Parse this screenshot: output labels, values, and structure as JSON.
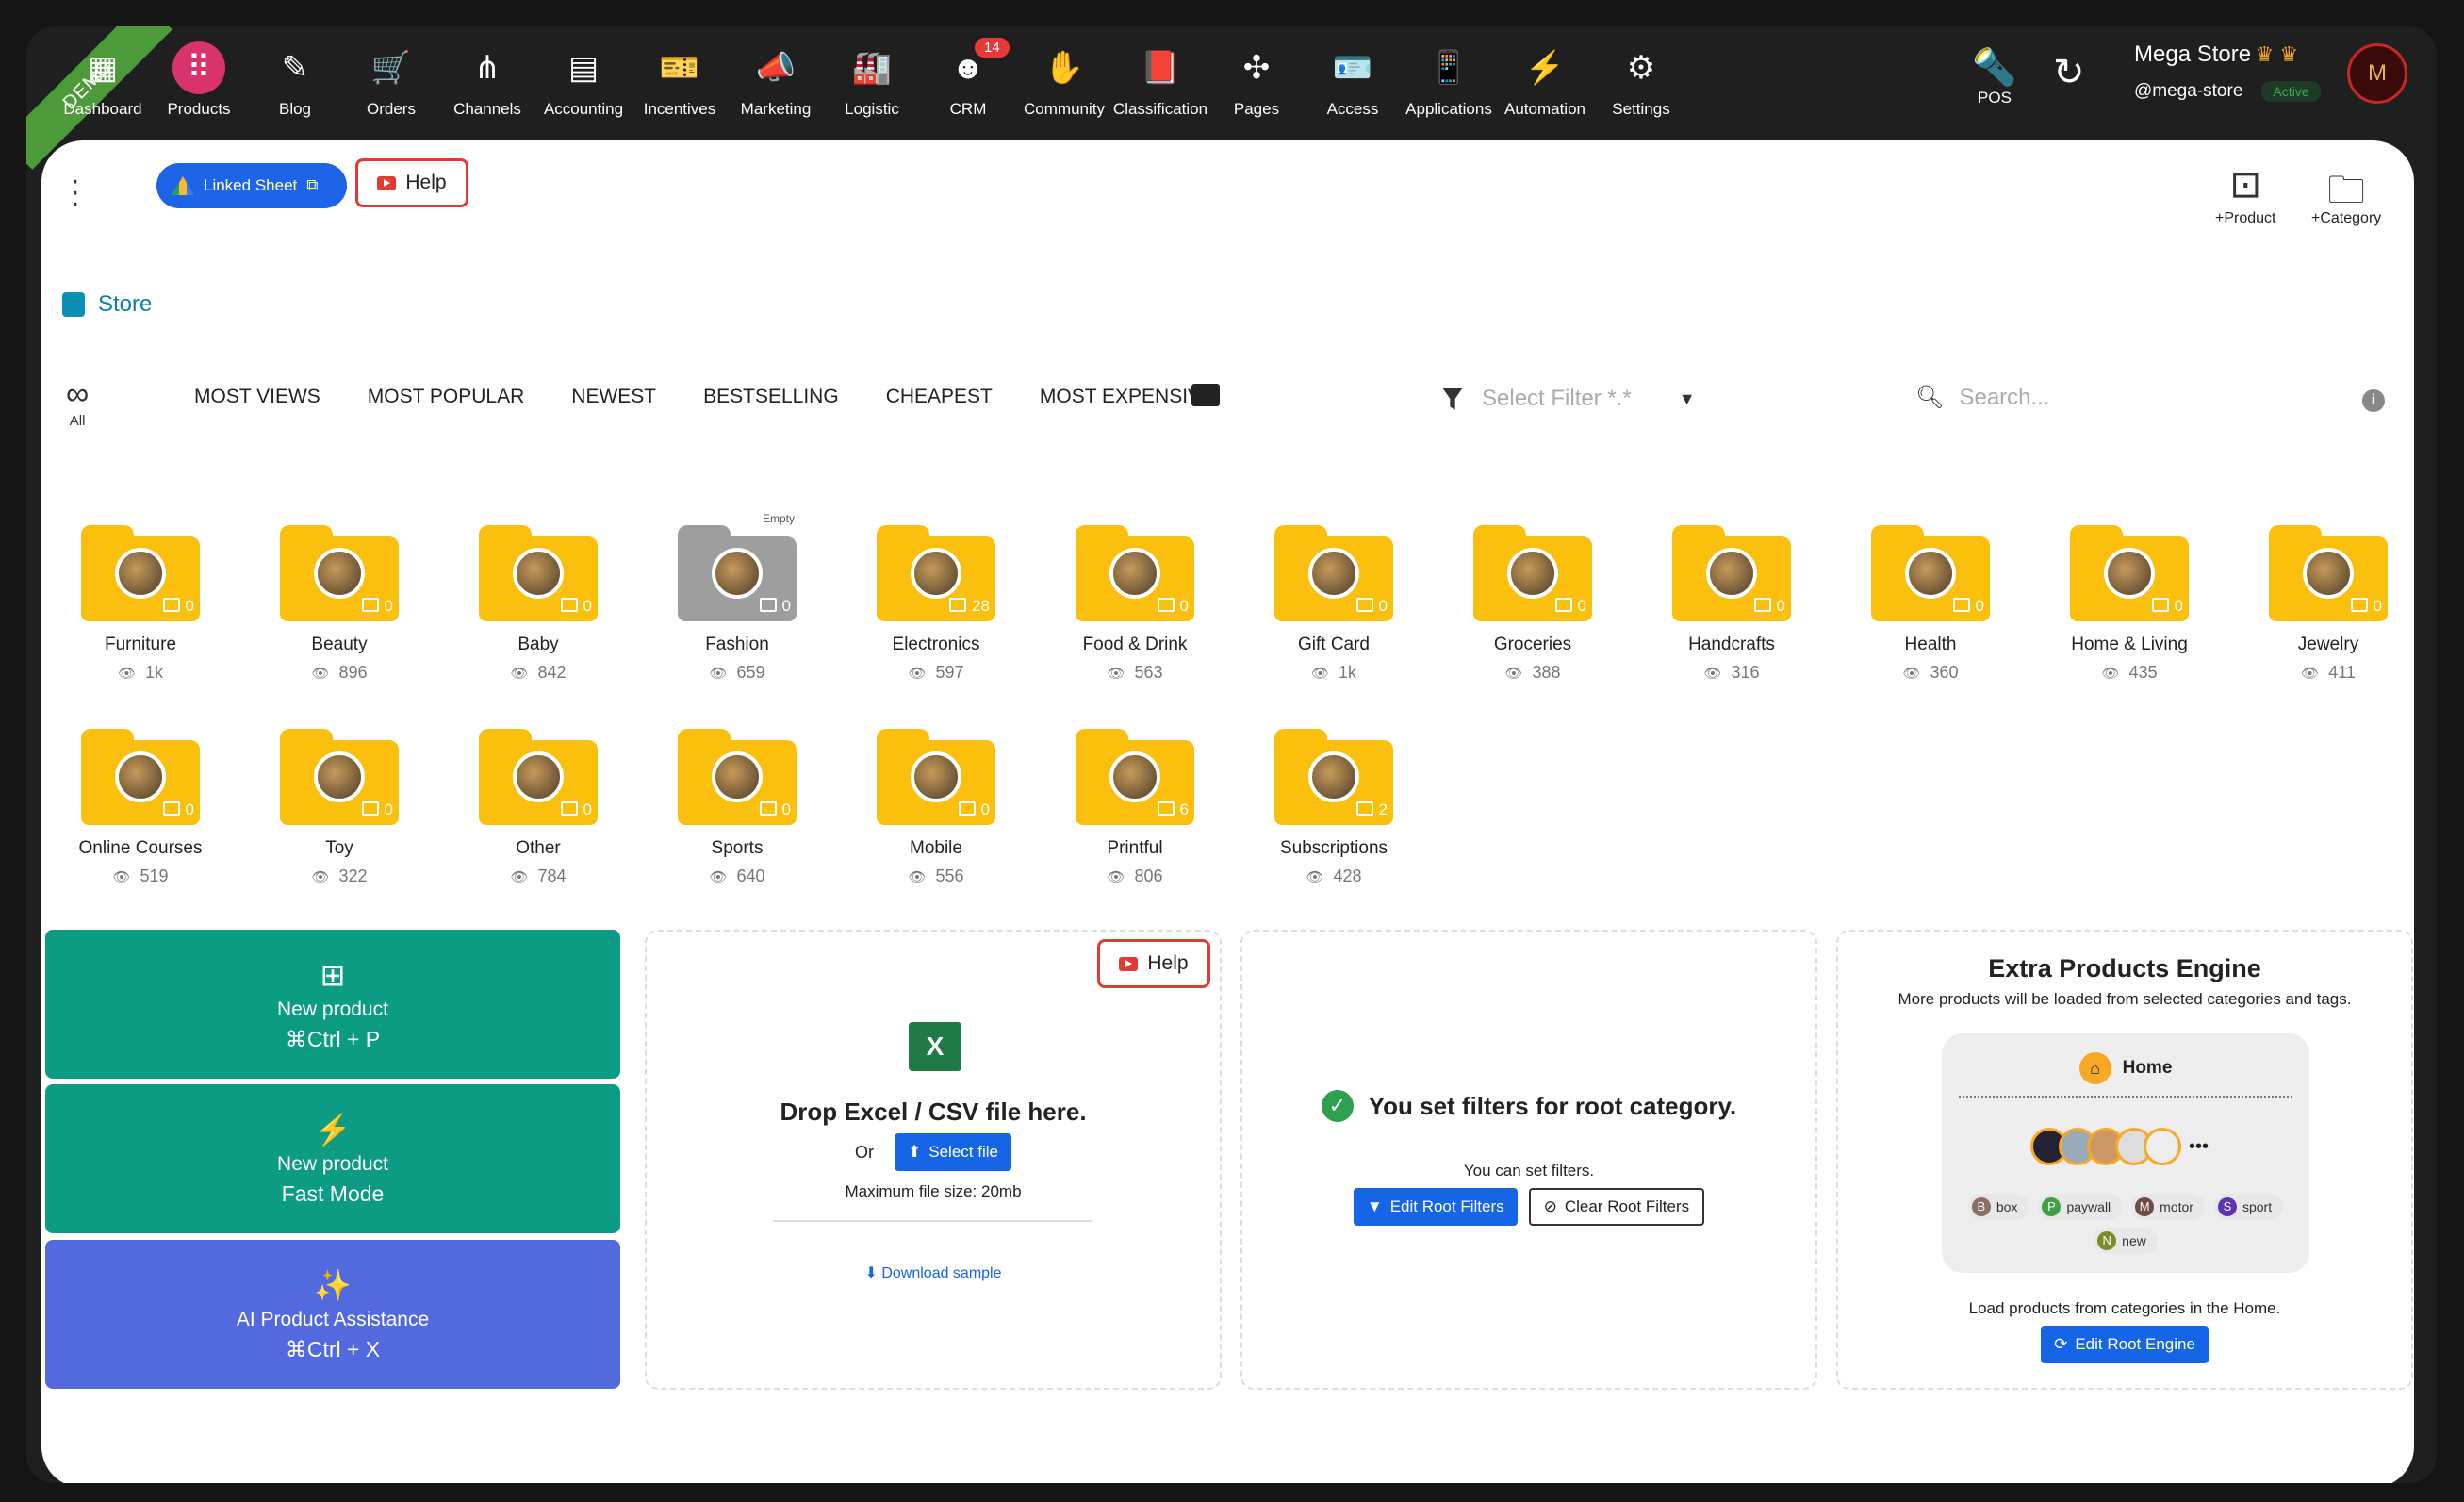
{
  "ribbon": "DEMO",
  "nav": [
    {
      "label": "Dashboard",
      "icon": "dashboard-icon",
      "glyph": "▦"
    },
    {
      "label": "Products",
      "icon": "grid-apps-icon",
      "glyph": "⠿"
    },
    {
      "label": "Blog",
      "icon": "blog-icon",
      "glyph": "✎"
    },
    {
      "label": "Orders",
      "icon": "cart-icon",
      "glyph": "🛒"
    },
    {
      "label": "Channels",
      "icon": "channels-icon",
      "glyph": "⋔"
    },
    {
      "label": "Accounting",
      "icon": "accounting-icon",
      "glyph": "▤"
    },
    {
      "label": "Incentives",
      "icon": "ticket-icon",
      "glyph": "🎫"
    },
    {
      "label": "Marketing",
      "icon": "megaphone-icon",
      "glyph": "📣"
    },
    {
      "label": "Logistic",
      "icon": "warehouse-icon",
      "glyph": "🏭"
    },
    {
      "label": "CRM",
      "icon": "crm-icon",
      "glyph": "☻",
      "badge": "14"
    },
    {
      "label": "Community",
      "icon": "hands-icon",
      "glyph": "✋"
    },
    {
      "label": "Classification",
      "icon": "book-icon",
      "glyph": "📕"
    },
    {
      "label": "Pages",
      "icon": "compass-icon",
      "glyph": "✣"
    },
    {
      "label": "Access",
      "icon": "badge-icon",
      "glyph": "🪪"
    },
    {
      "label": "Applications",
      "icon": "phone-icon",
      "glyph": "📱"
    },
    {
      "label": "Automation",
      "icon": "bolt-icon",
      "glyph": "⚡"
    },
    {
      "label": "Settings",
      "icon": "gear-icon",
      "glyph": "⚙"
    }
  ],
  "pos": {
    "label": "POS"
  },
  "store": {
    "name": "Mega Store",
    "crowns": "♛ ♛",
    "handle": "@mega-store",
    "status": "Active",
    "avatar": "M"
  },
  "toolbar": {
    "linked_sheet": "Linked Sheet",
    "help": "Help",
    "add_product": "+Product",
    "add_category": "+Category"
  },
  "breadcrumb": {
    "store": "Store"
  },
  "filters": {
    "all": "All",
    "sorts": [
      "MOST VIEWS",
      "MOST POPULAR",
      "NEWEST",
      "BESTSELLING",
      "CHEAPEST",
      "MOST EXPENSIVE"
    ],
    "select_filter": "Select Filter *.*",
    "search_placeholder": "Search..."
  },
  "categories": [
    {
      "name": "Furniture",
      "count": "0",
      "views": "1k"
    },
    {
      "name": "Beauty",
      "count": "0",
      "views": "896"
    },
    {
      "name": "Baby",
      "count": "0",
      "views": "842"
    },
    {
      "name": "Fashion",
      "count": "0",
      "views": "659",
      "empty": "Empty"
    },
    {
      "name": "Electronics",
      "count": "28",
      "views": "597"
    },
    {
      "name": "Food & Drink",
      "count": "0",
      "views": "563"
    },
    {
      "name": "Gift Card",
      "count": "0",
      "views": "1k"
    },
    {
      "name": "Groceries",
      "count": "0",
      "views": "388"
    },
    {
      "name": "Handcrafts",
      "count": "0",
      "views": "316"
    },
    {
      "name": "Health",
      "count": "0",
      "views": "360"
    },
    {
      "name": "Home & Living",
      "count": "0",
      "views": "435"
    },
    {
      "name": "Jewelry",
      "count": "0",
      "views": "411"
    },
    {
      "name": "Online Courses",
      "count": "0",
      "views": "519"
    },
    {
      "name": "Toy",
      "count": "0",
      "views": "322"
    },
    {
      "name": "Other",
      "count": "0",
      "views": "784"
    },
    {
      "name": "Sports",
      "count": "0",
      "views": "640"
    },
    {
      "name": "Mobile",
      "count": "0",
      "views": "556"
    },
    {
      "name": "Printful",
      "count": "6",
      "views": "806"
    },
    {
      "name": "Subscriptions",
      "count": "2",
      "views": "428"
    }
  ],
  "actions": {
    "new_product": {
      "label": "New product",
      "shortcut": "⌘Ctrl + P"
    },
    "fast_mode": {
      "label": "New product",
      "sub": "Fast Mode"
    },
    "ai": {
      "label": "AI Product Assistance",
      "shortcut": "⌘Ctrl + X"
    }
  },
  "import": {
    "help": "Help",
    "title": "Drop Excel / CSV file here.",
    "or": "Or",
    "select": "Select file",
    "max": "Maximum file size: 20mb",
    "download": "Download sample"
  },
  "root_filters": {
    "title": "You set filters for root category.",
    "sub": "You can set filters.",
    "edit": "Edit Root Filters",
    "clear": "Clear Root Filters"
  },
  "engine": {
    "title": "Extra Products Engine",
    "desc": "More products will be loaded from selected categories and tags.",
    "home": "Home",
    "more": "•••",
    "tags": [
      {
        "letter": "B",
        "name": "box",
        "color": "#8d6e63"
      },
      {
        "letter": "P",
        "name": "paywall",
        "color": "#43a047"
      },
      {
        "letter": "M",
        "name": "motor",
        "color": "#6d4c41"
      },
      {
        "letter": "S",
        "name": "sport",
        "color": "#5e35b1"
      },
      {
        "letter": "N",
        "name": "new",
        "color": "#7d8b2a"
      }
    ],
    "footer": "Load products from categories in the Home.",
    "edit": "Edit Root Engine"
  },
  "colors": {
    "accent": "#1665e6",
    "teal": "#0c9c84",
    "purple": "#5369de",
    "folder": "#fbbf0e",
    "pink": "#d8336c"
  }
}
